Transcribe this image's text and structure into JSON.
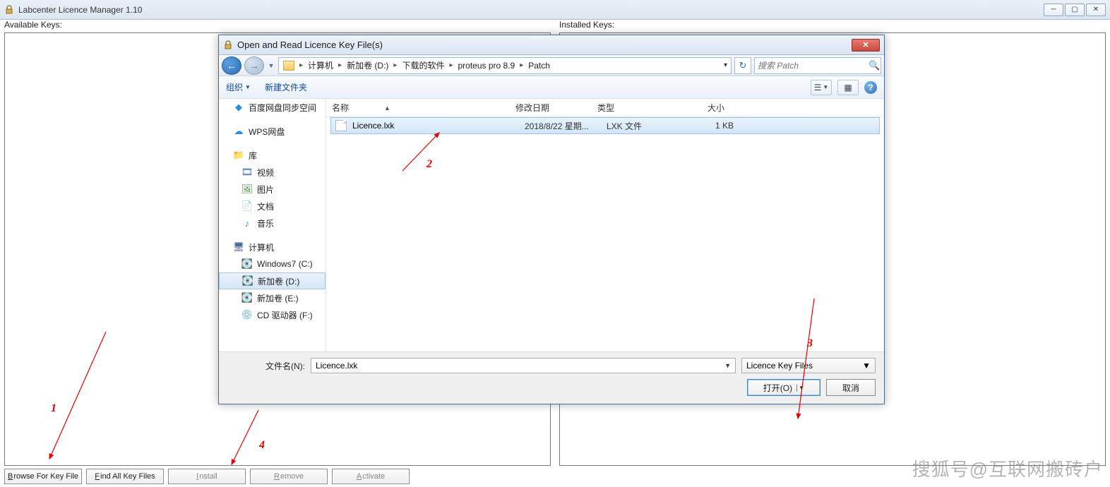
{
  "main": {
    "title": "Labcenter Licence Manager 1.10",
    "available_label": "Available Keys:",
    "installed_label": "Installed Keys:",
    "buttons": {
      "browse": "rowse For Key File",
      "browse_u": "B",
      "find": "ind All Key Files",
      "find_u": "F",
      "install": "nstall",
      "install_u": "I",
      "remove": "emove",
      "remove_u": "R",
      "activate": "ctivate",
      "activate_u": "A"
    }
  },
  "dialog": {
    "title": "Open and Read Licence Key File(s)",
    "breadcrumb": [
      "计算机",
      "新加卷 (D:)",
      "下载的软件",
      "proteus pro 8.9",
      "Patch"
    ],
    "search_placeholder": "搜索 Patch",
    "toolbar": {
      "organize": "组织",
      "newfolder": "新建文件夹"
    },
    "tree": [
      {
        "label": "百度网盘同步空间",
        "icon": "◆",
        "color": "#2b8edb"
      },
      {
        "label": "",
        "spacer": true
      },
      {
        "label": "WPS网盘",
        "icon": "☁",
        "color": "#2b8edb"
      },
      {
        "label": "",
        "spacer": true
      },
      {
        "label": "库",
        "icon": "📁",
        "color": "#d9a94a"
      },
      {
        "label": "视频",
        "icon": "🎞",
        "color": "#3b6db5",
        "indent": true
      },
      {
        "label": "图片",
        "icon": "🖼",
        "color": "#3b8b3b",
        "indent": true
      },
      {
        "label": "文档",
        "icon": "📄",
        "color": "#666",
        "indent": true
      },
      {
        "label": "音乐",
        "icon": "♪",
        "color": "#2b8edb",
        "indent": true
      },
      {
        "label": "",
        "spacer": true
      },
      {
        "label": "计算机",
        "icon": "🖥",
        "color": "#4a6a94"
      },
      {
        "label": "Windows7 (C:)",
        "icon": "💽",
        "color": "#5a7db5",
        "indent": true
      },
      {
        "label": "新加卷 (D:)",
        "icon": "💽",
        "color": "#888",
        "indent": true,
        "selected": true
      },
      {
        "label": "新加卷 (E:)",
        "icon": "💽",
        "color": "#888",
        "indent": true
      },
      {
        "label": "CD 驱动器 (F:)",
        "icon": "💿",
        "color": "#c0a030",
        "indent": true
      }
    ],
    "columns": {
      "name": "名称",
      "date": "修改日期",
      "type": "类型",
      "size": "大小"
    },
    "file": {
      "name": "Licence.lxk",
      "date": "2018/8/22 星期...",
      "type": "LXK 文件",
      "size": "1 KB"
    },
    "filename_label": "文件名(N):",
    "filename_value": "Licence.lxk",
    "filter": "Licence Key Files",
    "open_btn": "打开(O)",
    "cancel_btn": "取消"
  },
  "annotations": {
    "n1": "1",
    "n2": "2",
    "n3": "3",
    "n4": "4"
  },
  "watermark": "搜狐号@互联网搬砖户"
}
